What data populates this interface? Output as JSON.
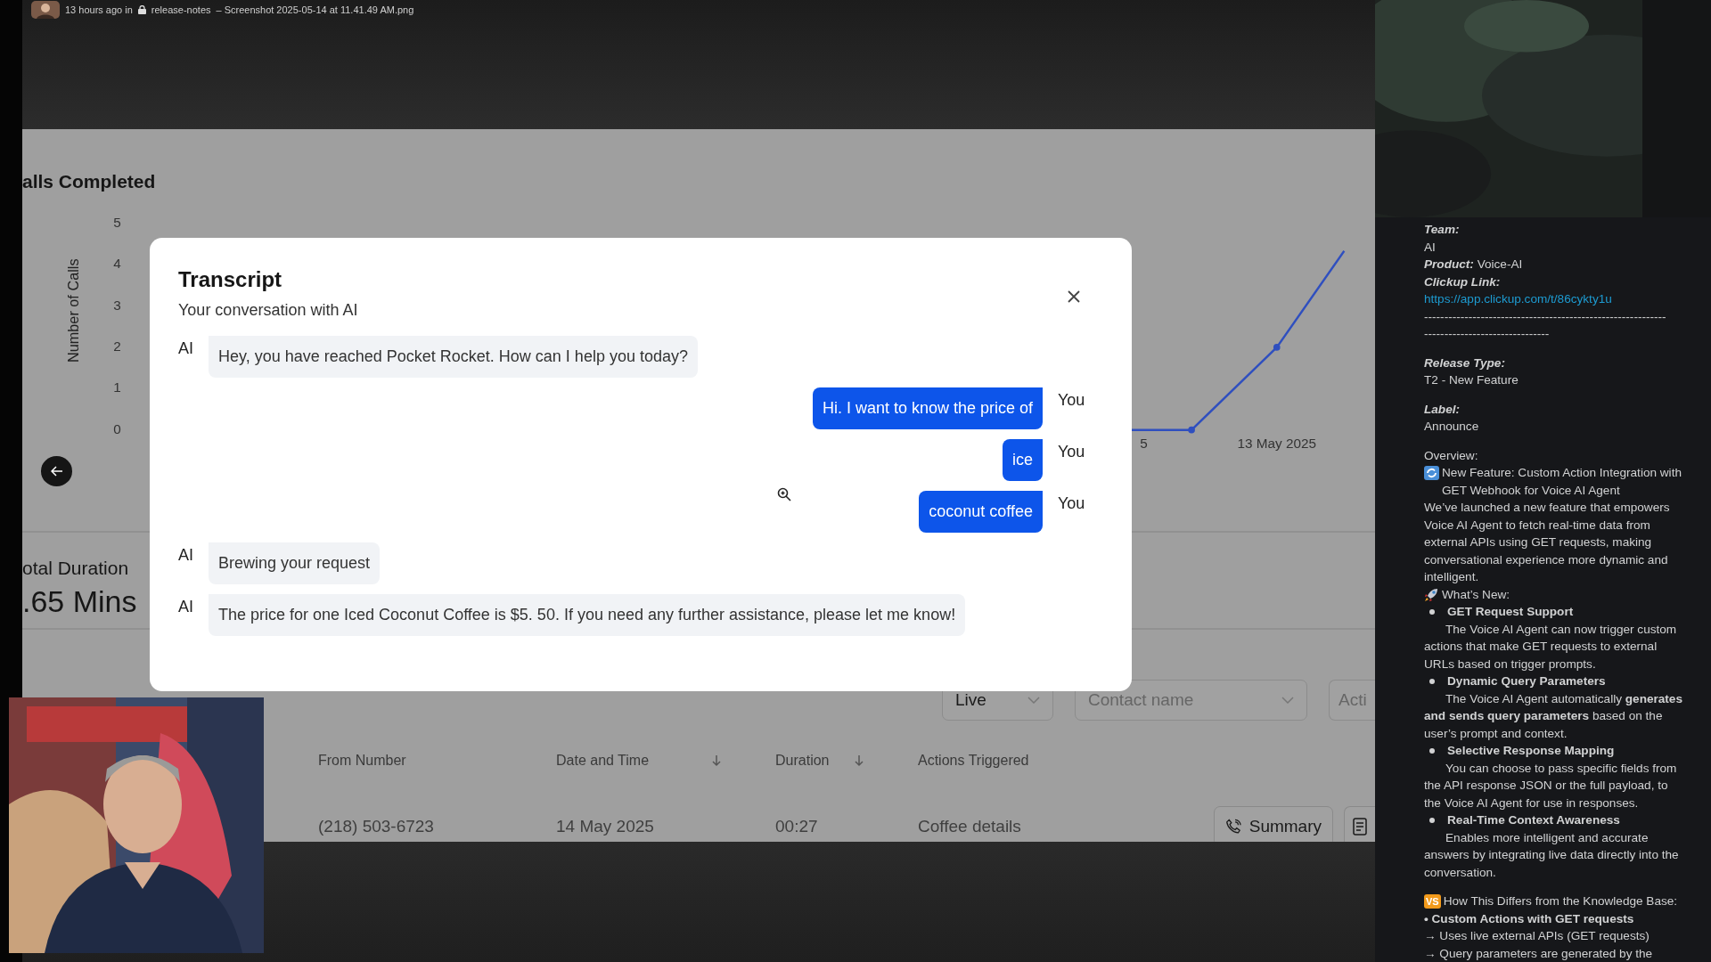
{
  "message_header": {
    "meta": "13 hours ago in",
    "channel": "release-notes",
    "file": "– Screenshot 2025-05-14 at 11.41.49 AM.png"
  },
  "dashboard": {
    "chart_title": "alls Completed",
    "chart": {
      "ylabel": "Number of Calls",
      "y_tick_labels": [
        "5",
        "4",
        "3",
        "2",
        "1",
        "0"
      ],
      "x_tick_labels": [
        "5",
        "13 May 2025"
      ]
    },
    "duration_label": "otal Duration",
    "duration_value": ".65 Mins",
    "filters": [
      {
        "kind": "select",
        "text": "Live",
        "placeholder": false
      },
      {
        "kind": "select",
        "text": "Contact name",
        "placeholder": true
      },
      {
        "kind": "field",
        "text": "Acti",
        "placeholder": true
      }
    ],
    "table": {
      "columns": [
        {
          "label": "From Number",
          "sort": false
        },
        {
          "label": "Date and Time",
          "sort": true
        },
        {
          "label": "Duration",
          "sort": true
        },
        {
          "label": "Actions Triggered",
          "sort": false
        }
      ],
      "rows": [
        {
          "cells": [
            "(218) 503-6723",
            "14 May 2025",
            "00:27",
            "Coffee details"
          ],
          "action": "Summary"
        }
      ]
    }
  },
  "modal": {
    "title": "Transcript",
    "subtitle": "Your conversation with AI",
    "messages": [
      {
        "speaker": "AI",
        "from_user": false,
        "text": "Hey, you have reached Pocket Rocket. How can I help you today?"
      },
      {
        "speaker": "You",
        "from_user": true,
        "text": "Hi. I want to know the price of"
      },
      {
        "speaker": "You",
        "from_user": true,
        "text": "ice"
      },
      {
        "speaker": "You",
        "from_user": true,
        "text": "coconut coffee"
      },
      {
        "speaker": "AI",
        "from_user": false,
        "text": "Brewing your request"
      },
      {
        "speaker": "AI",
        "from_user": false,
        "text": "The price for one Iced Coconut Coffee is $5. 50. If you need any further assistance, please let me know!"
      }
    ]
  },
  "release_note": [
    {
      "kind": "label",
      "text": "Team:"
    },
    {
      "kind": "text",
      "text": "AI"
    },
    {
      "kind": "pair",
      "label": "Product:",
      "text": "Voice-AI"
    },
    {
      "kind": "label",
      "text": "Clickup Link:"
    },
    {
      "kind": "link",
      "text": "https://app.clickup.com/t/86cykty1u"
    },
    {
      "kind": "text",
      "text": "------------------------------------------------------------"
    },
    {
      "kind": "text",
      "text": "-------------------------------"
    },
    {
      "kind": "section_label",
      "text": "Release Type:"
    },
    {
      "kind": "text",
      "text": "T2 - New Feature"
    },
    {
      "kind": "section_label",
      "text": "Label:"
    },
    {
      "kind": "text",
      "text": "Announce"
    },
    {
      "kind": "section_text",
      "text": "Overview:"
    },
    {
      "kind": "refresh_item",
      "text": "New Feature: Custom Action Integration with GET Webhook for Voice AI Agent"
    },
    {
      "kind": "text",
      "text": "We’ve launched a new feature that empowers Voice AI Agent to fetch real-time data from external APIs using GET requests, making conversational experience more dynamic and intelligent."
    },
    {
      "kind": "rocket_item",
      "text": "What’s New:"
    },
    {
      "kind": "bullet",
      "text": "GET Request Support"
    },
    {
      "kind": "indent",
      "text": "The Voice AI Agent can now trigger custom actions that make GET requests to external URLs based on trigger prompts."
    },
    {
      "kind": "bullet",
      "text": "Dynamic Query Parameters"
    },
    {
      "kind": "indent",
      "text": "The Voice AI Agent automatically **generates and sends query parameters** based on the user’s prompt and context."
    },
    {
      "kind": "bullet",
      "text": "Selective Response Mapping"
    },
    {
      "kind": "indent",
      "text": "You can choose to pass specific fields from the API response JSON or the full payload, to the Voice AI Agent for use in responses."
    },
    {
      "kind": "bullet",
      "text": "Real-Time Context Awareness"
    },
    {
      "kind": "indent",
      "text": "Enables more intelligent and accurate answers by integrating live data directly into the conversation."
    },
    {
      "kind": "badge",
      "badge": "VS",
      "text": "How This Differs from the Knowledge Base:"
    },
    {
      "kind": "bold",
      "text": "• Custom Actions with GET requests"
    },
    {
      "kind": "text",
      "text": " → Uses live external APIs (GET requests)"
    },
    {
      "kind": "text",
      "text": " → Query parameters are generated by the"
    }
  ]
}
